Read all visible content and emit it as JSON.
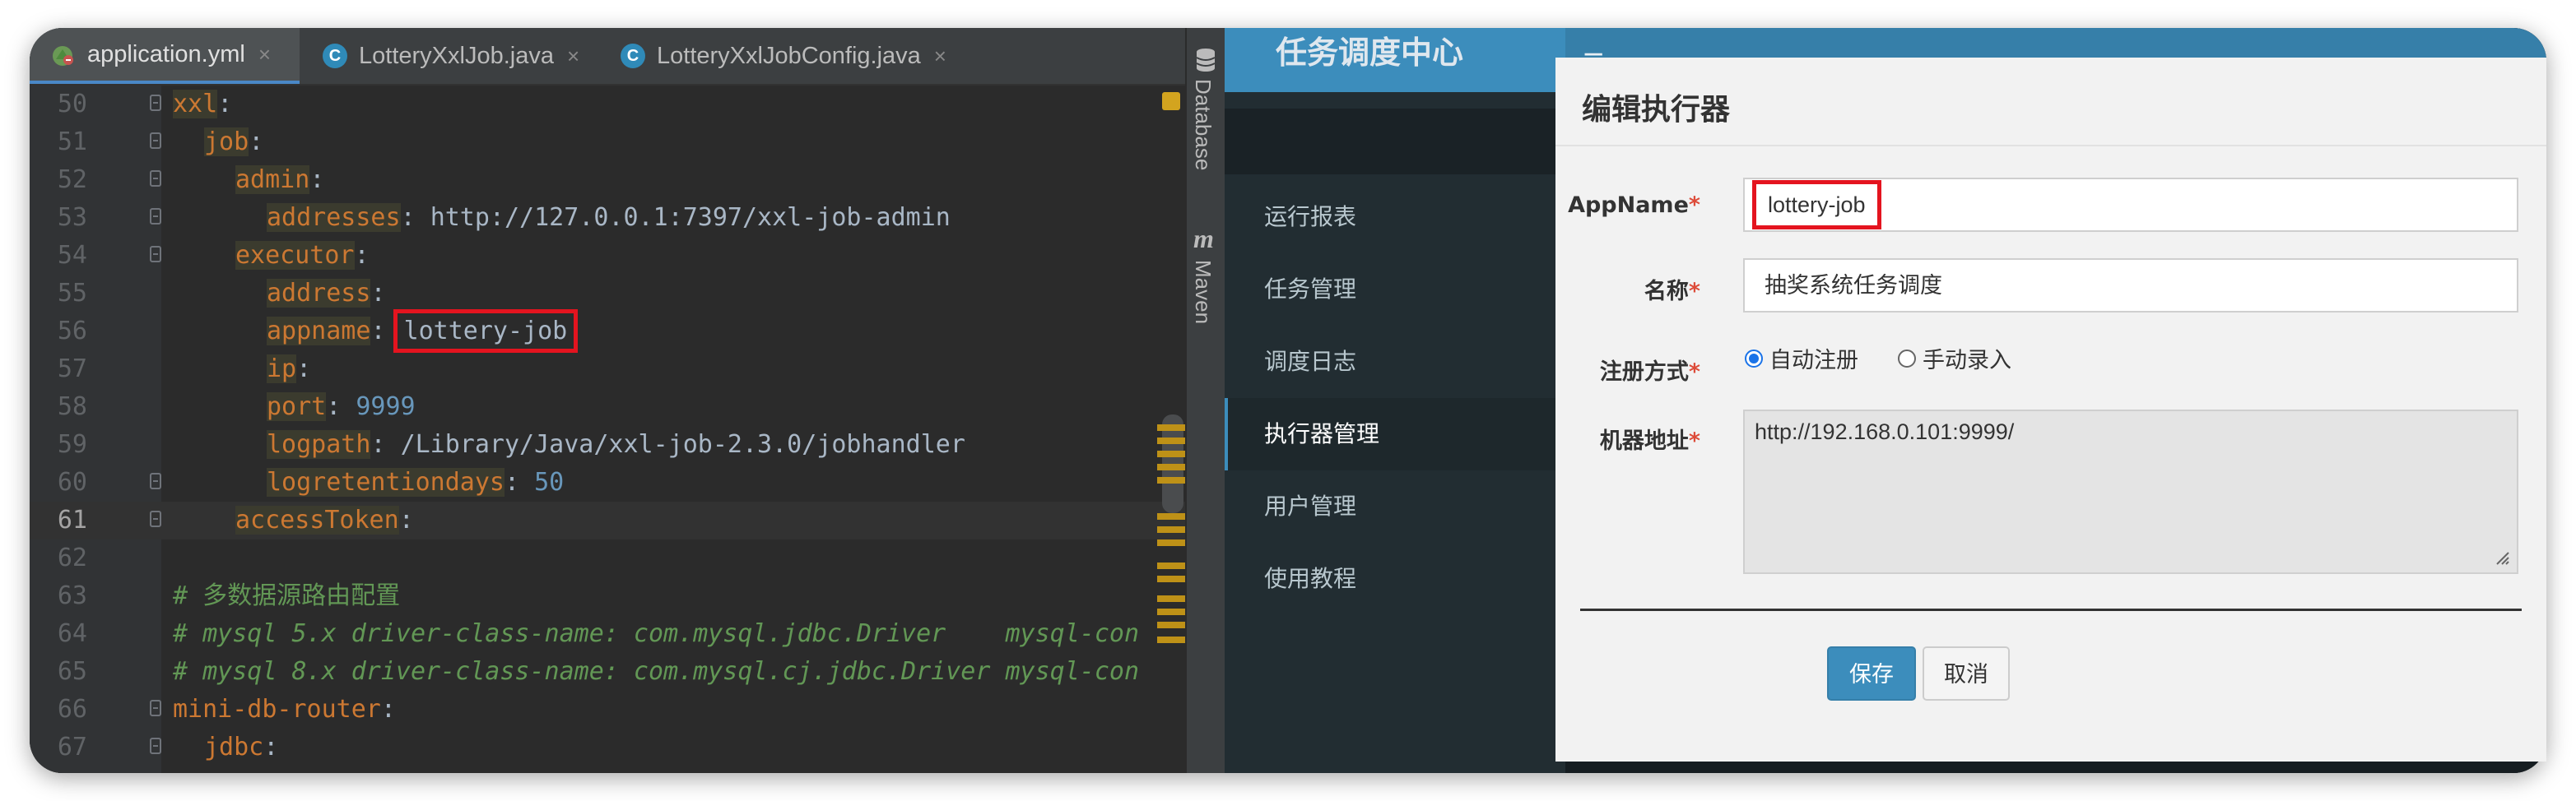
{
  "ide": {
    "tabs": [
      {
        "label": "application.yml",
        "close": "×"
      },
      {
        "label": "LotteryXxlJob.java",
        "close": "×"
      },
      {
        "label": "LotteryXxlJobConfig.java",
        "close": "×"
      }
    ],
    "tool_windows": {
      "database": "Database",
      "maven": "Maven",
      "maven_glyph": "m"
    },
    "lines": [
      {
        "num": "50",
        "key": "xxl",
        "punct": ":"
      },
      {
        "num": "51",
        "key": "job",
        "punct": ":"
      },
      {
        "num": "52",
        "key": "admin",
        "punct": ":"
      },
      {
        "num": "53",
        "key": "addresses",
        "punct": ": ",
        "value": "http://127.0.0.1:7397/xxl-job-admin"
      },
      {
        "num": "54",
        "key": "executor",
        "punct": ":"
      },
      {
        "num": "55",
        "key": "address",
        "punct": ":"
      },
      {
        "num": "56",
        "key": "appname",
        "punct": ": ",
        "value": "lottery-job"
      },
      {
        "num": "57",
        "key": "ip",
        "punct": ":"
      },
      {
        "num": "58",
        "key": "port",
        "punct": ": ",
        "value": "9999"
      },
      {
        "num": "59",
        "key": "logpath",
        "punct": ": ",
        "value": "/Library/Java/xxl-job-2.3.0/jobhandler"
      },
      {
        "num": "60",
        "key": "logretentiondays",
        "punct": ": ",
        "value": "50"
      },
      {
        "num": "61",
        "key": "accessToken",
        "punct": ":"
      },
      {
        "num": "62"
      },
      {
        "num": "63",
        "comment": "# 多数据源路由配置"
      },
      {
        "num": "64",
        "comment": "# mysql 5.x driver-class-name: com.mysql.jdbc.Driver    mysql-con"
      },
      {
        "num": "65",
        "comment": "# mysql 8.x driver-class-name: com.mysql.cj.jdbc.Driver mysql-con"
      },
      {
        "num": "66",
        "key": "mini-db-router",
        "punct": ":"
      },
      {
        "num": "67",
        "key": "jdbc",
        "punct": ":"
      }
    ]
  },
  "admin": {
    "brand": "任务调度中心",
    "menu_icon": "≡",
    "sidebar": [
      {
        "label": "运行报表"
      },
      {
        "label": "任务管理"
      },
      {
        "label": "调度日志"
      },
      {
        "label": "执行器管理"
      },
      {
        "label": "用户管理"
      },
      {
        "label": "使用教程"
      }
    ],
    "modal": {
      "title": "编辑执行器",
      "required_mark": "*",
      "appname_label": "AppName",
      "appname_value": "lottery-job",
      "name_label": "名称",
      "name_value": "抽奖系统任务调度",
      "reg_label": "注册方式",
      "reg_auto": "自动注册",
      "reg_manual": "手动录入",
      "addr_label": "机器地址",
      "addr_value": "http://192.168.0.101:9999/",
      "save": "保存",
      "cancel": "取消"
    }
  },
  "colors": {
    "highlight_box": "#e4141f",
    "accent": "#3c8dbc"
  }
}
